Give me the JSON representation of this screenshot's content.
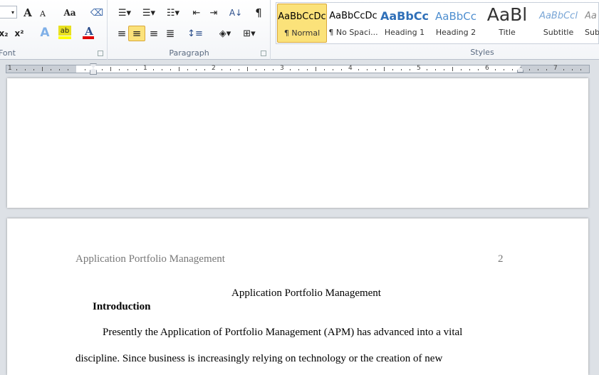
{
  "ribbon": {
    "font_group": {
      "label": "Font",
      "grow": "A",
      "shrink": "A",
      "change_case": "Aa",
      "subscript": "x₂",
      "superscript": "x²",
      "text_effects": "A",
      "highlight": "ab",
      "font_color": "A"
    },
    "paragraph_group": {
      "label": "Paragraph",
      "sort": "A↓",
      "show_marks": "¶"
    },
    "styles_group": {
      "label": "Styles",
      "items": [
        {
          "preview": "AaBbCcDc",
          "name": "¶ Normal",
          "selected": true
        },
        {
          "preview": "AaBbCcDc",
          "name": "¶ No Spaci..."
        },
        {
          "preview": "AaBbCc",
          "name": "Heading 1"
        },
        {
          "preview": "AaBbCc",
          "name": "Heading 2"
        },
        {
          "preview": "AaBl",
          "name": "Title"
        },
        {
          "preview": "AaBbCcl",
          "name": "Subtitle"
        },
        {
          "preview": "Aa",
          "name": "Sub"
        }
      ]
    },
    "highlight_color": "#ffff00",
    "font_color_bar": "#e00000",
    "selected_color": "#fbe27a"
  },
  "ruler": {
    "numbers": [
      "1",
      "1",
      "2",
      "3",
      "4",
      "5",
      "6",
      "7"
    ]
  },
  "document": {
    "header_title": "Application Portfolio Management",
    "page_number": "2",
    "title": "Application Portfolio Management",
    "heading": "Introduction",
    "lines": [
      "Presently the Application of Portfolio Management (APM) has advanced into a vital",
      "discipline. Since business is increasingly relying on technology or the creation of new"
    ]
  }
}
